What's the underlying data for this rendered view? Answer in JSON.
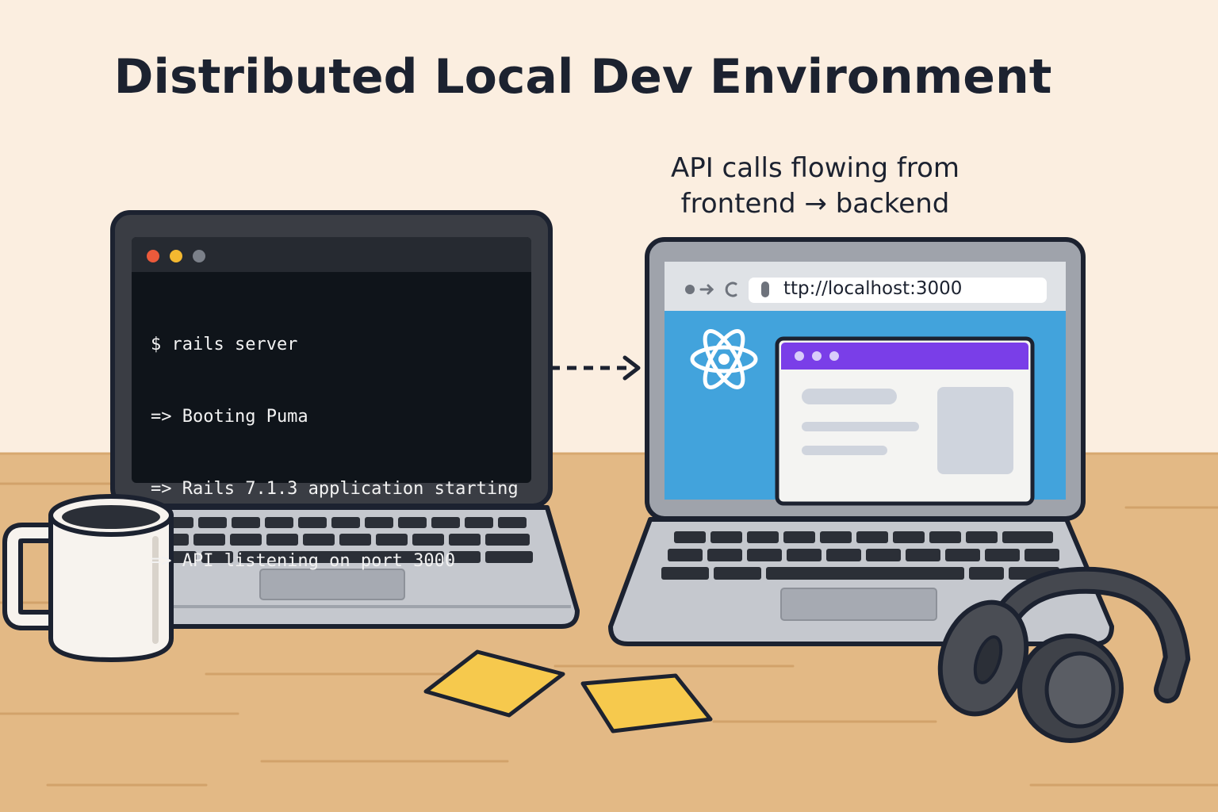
{
  "title": "Distributed Local Dev Environment",
  "caption": {
    "line1": "API calls flowing from",
    "line2": "frontend → backend"
  },
  "terminal": {
    "lines": [
      "$ rails server",
      "=> Booting Puma",
      "=> Rails 7.1.3 application starting",
      "=> API listening on port 3000"
    ]
  },
  "browser": {
    "url": "ttp://localhost:3000"
  },
  "colors": {
    "background": "#fbeee0",
    "desk": "#e3b985",
    "outline": "#1c2230",
    "terminal_bg": "#0f141a",
    "browser_blue": "#42a3dc",
    "purple_bar": "#7a3ee8",
    "sticky_note": "#f6c94d",
    "react_logo": "#ffffff"
  },
  "icons": [
    "react-logo-icon",
    "back-arrow-icon",
    "forward-arrow-icon",
    "reload-icon",
    "lock-icon"
  ]
}
